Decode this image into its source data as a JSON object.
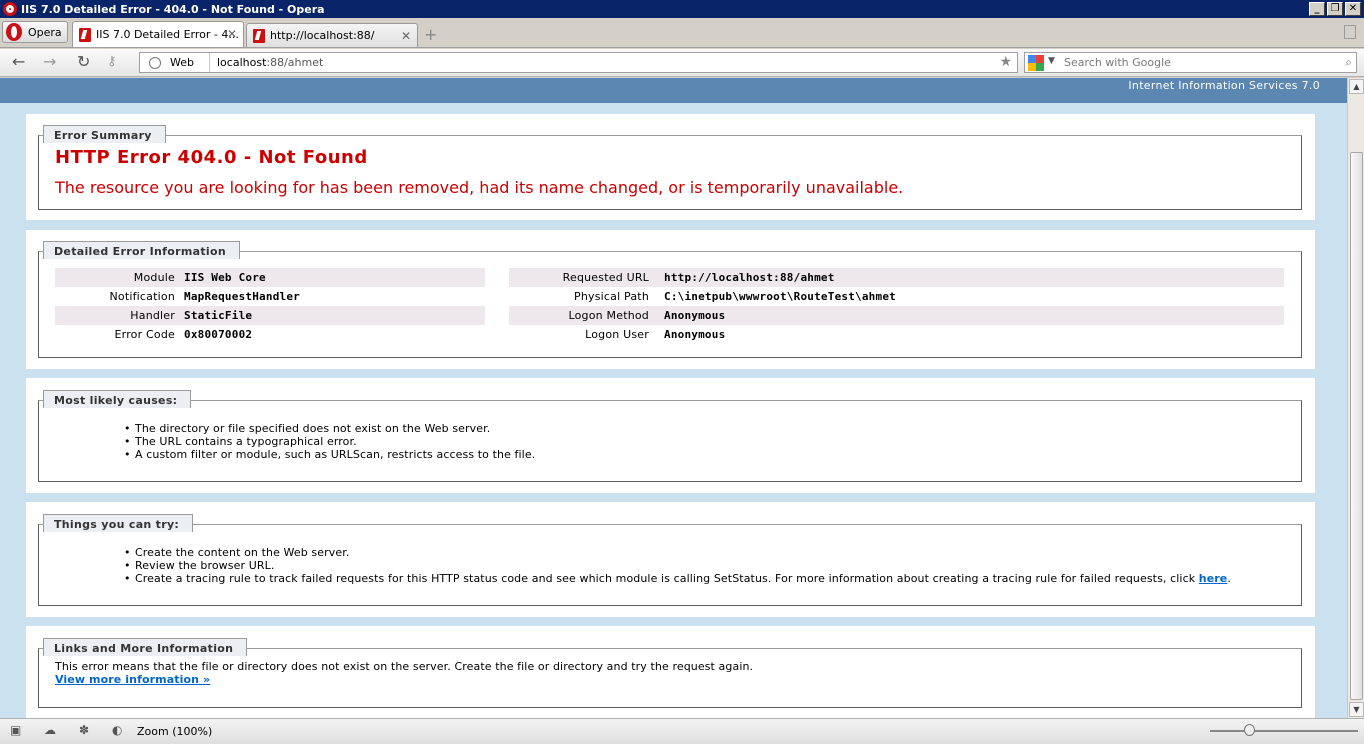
{
  "window": {
    "title": "IIS 7.0 Detailed Error - 404.0 - Not Found - Opera",
    "minimize_label": "_",
    "restore_label": "❐",
    "close_label": "✕"
  },
  "tabs": {
    "menu_label": "Opera",
    "items": [
      {
        "label": "IIS 7.0 Detailed Error - 4..."
      },
      {
        "label": "http://localhost:88/"
      }
    ],
    "close_glyph": "✕",
    "new_tab_glyph": "+"
  },
  "nav": {
    "mode_label": "Web",
    "url_host": "localhost",
    "url_rest": ":88/ahmet",
    "search_placeholder": "Search with Google"
  },
  "page": {
    "server_label": "Internet Information Services 7.0",
    "summary": {
      "legend": "Error Summary",
      "heading": "HTTP Error 404.0 - Not Found",
      "message": "The resource you are looking for has been removed, had its name changed, or is temporarily unavailable."
    },
    "details": {
      "legend": "Detailed Error Information",
      "left": [
        {
          "label": "Module",
          "value": "IIS Web Core"
        },
        {
          "label": "Notification",
          "value": "MapRequestHandler"
        },
        {
          "label": "Handler",
          "value": "StaticFile"
        },
        {
          "label": "Error Code",
          "value": "0x80070002"
        }
      ],
      "right": [
        {
          "label": "Requested URL",
          "value": "http://localhost:88/ahmet"
        },
        {
          "label": "Physical Path",
          "value": "C:\\inetpub\\wwwroot\\RouteTest\\ahmet"
        },
        {
          "label": "Logon Method",
          "value": "Anonymous"
        },
        {
          "label": "Logon User",
          "value": "Anonymous"
        }
      ]
    },
    "causes": {
      "legend": "Most likely causes:",
      "items": [
        "The directory or file specified does not exist on the Web server.",
        "The URL contains a typographical error.",
        "A custom filter or module, such as URLScan, restricts access to the file."
      ]
    },
    "try": {
      "legend": "Things you can try:",
      "items": [
        "Create the content on the Web server.",
        "Review the browser URL.",
        "Create a tracing rule to track failed requests for this HTTP status code and see which module is calling SetStatus. For more information about creating a tracing rule for failed requests, click "
      ],
      "link_text": "here",
      "after_link": "."
    },
    "links": {
      "legend": "Links and More Information",
      "text": "This error means that the file or directory does not exist on the server. Create the file or directory and try the request again.",
      "more_link": "View more information »"
    }
  },
  "status": {
    "zoom_label": "Zoom (100%)",
    "zoom_percent": 100
  },
  "colors": {
    "iis_header": "#5c87b2",
    "page_background": "#cbe1ef",
    "error_red": "#cc0000",
    "link_blue": "#0066cc"
  }
}
